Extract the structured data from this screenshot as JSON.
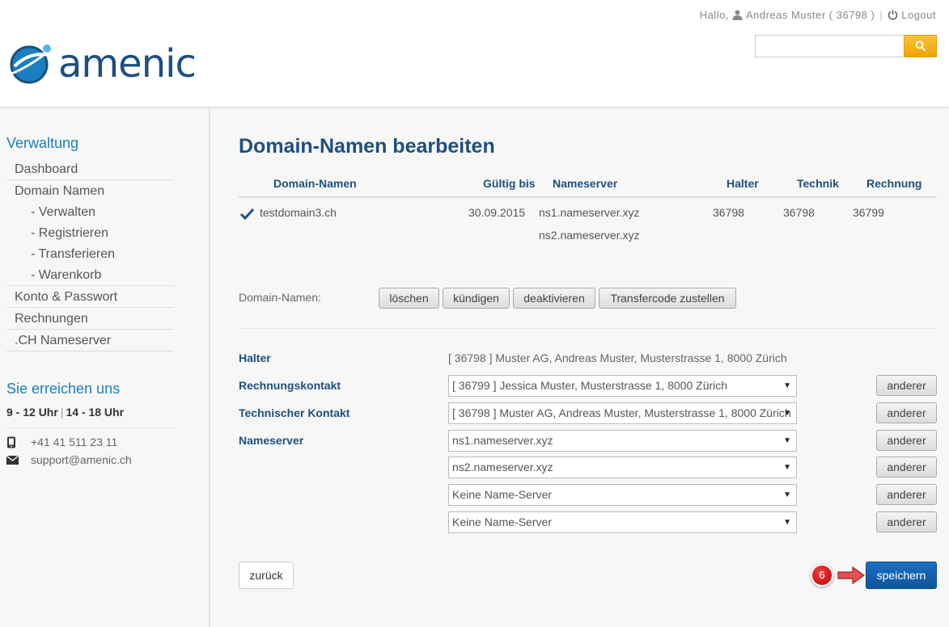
{
  "header": {
    "logo_text": "amenic",
    "greeting": "Hallo,",
    "user": "Andreas Muster ( 36798 )",
    "separator": "|",
    "logout": "Logout",
    "search_value": ""
  },
  "sidebar": {
    "admin_title": "Verwaltung",
    "nav": [
      {
        "label": "Dashboard"
      },
      {
        "label": "Domain Namen"
      },
      {
        "label": "- Verwalten"
      },
      {
        "label": "- Registrieren"
      },
      {
        "label": "- Transferieren"
      },
      {
        "label": "- Warenkorb"
      },
      {
        "label": "Konto & Passwort"
      },
      {
        "label": "Rechnungen"
      },
      {
        "label": ".CH Nameserver"
      }
    ],
    "contact_title": "Sie erreichen uns",
    "hours_a": "9 - 12 Uhr",
    "hours_sep": "|",
    "hours_b": "14 - 18 Uhr",
    "phone": "+41 41 511 23 11",
    "email": "support@amenic.ch"
  },
  "main": {
    "title": "Domain-Namen bearbeiten",
    "columns": {
      "domain": "Domain-Namen",
      "valid": "Gültig bis",
      "ns": "Nameserver",
      "holder": "Halter",
      "tech": "Technik",
      "billing": "Rechnung"
    },
    "row": {
      "domain": "testdomain3.ch",
      "valid": "30.09.2015",
      "ns1": "ns1.nameserver.xyz",
      "ns2": "ns2.nameserver.xyz",
      "holder": "36798",
      "tech": "36798",
      "billing": "36799"
    },
    "actions_label": "Domain-Namen:",
    "actions": {
      "delete": "löschen",
      "cancel": "kündigen",
      "deactivate": "deaktivieren",
      "transfer_code": "Transfercode zustellen"
    },
    "form": {
      "holder_label": "Halter",
      "holder_value": "[ 36798 ] Muster AG, Andreas Muster, Musterstrasse 1, 8000 Zürich",
      "billing_label": "Rechnungskontakt",
      "billing_value": "[ 36799 ] Jessica Muster, Musterstrasse 1, 8000 Zürich",
      "tech_label": "Technischer Kontakt",
      "tech_value": "[ 36798 ] Muster AG, Andreas Muster, Musterstrasse 1, 8000 Zürich",
      "ns_label": "Nameserver",
      "ns_values": [
        "ns1.nameserver.xyz",
        "ns2.nameserver.xyz",
        "Keine Name-Server",
        "Keine Name-Server"
      ],
      "other_label": "anderer"
    },
    "back_label": "zurück",
    "save_label": "speichern",
    "step_number": "6"
  },
  "colors": {
    "brand": "#1d4f80",
    "link": "#1a7fc1",
    "search_button": "#f0a300",
    "save_button": "#0f559e",
    "badge": "#c00000"
  },
  "icons": [
    "user-icon",
    "power-icon",
    "search-icon",
    "checkmark-icon",
    "phone-icon",
    "envelope-icon",
    "arrow-right-icon"
  ]
}
